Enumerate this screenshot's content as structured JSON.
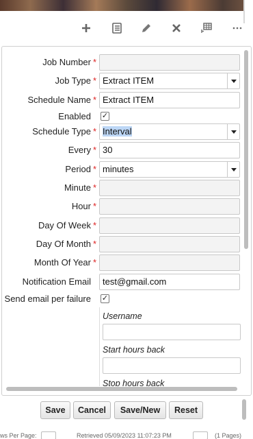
{
  "toolbar": {
    "icons": [
      "add-icon",
      "details-icon",
      "edit-icon",
      "delete-icon",
      "columns-icon",
      "more-icon"
    ]
  },
  "form": {
    "job_number": {
      "label": "Job Number",
      "value": ""
    },
    "job_type": {
      "label": "Job Type",
      "value": "Extract ITEM"
    },
    "schedule_name": {
      "label": "Schedule Name",
      "value": "Extract ITEM"
    },
    "enabled": {
      "label": "Enabled",
      "checked": true
    },
    "schedule_type": {
      "label": "Schedule Type",
      "value": "Interval"
    },
    "every": {
      "label": "Every",
      "value": "30"
    },
    "period": {
      "label": "Period",
      "value": "minutes"
    },
    "minute": {
      "label": "Minute",
      "value": ""
    },
    "hour": {
      "label": "Hour",
      "value": ""
    },
    "day_of_week": {
      "label": "Day Of Week",
      "value": ""
    },
    "day_of_month": {
      "label": "Day Of Month",
      "value": ""
    },
    "month_of_year": {
      "label": "Month Of Year",
      "value": ""
    },
    "notification_email": {
      "label": "Notification Email",
      "value": "test@gmail.com"
    },
    "send_email_per_failure": {
      "label": "Send email per failure",
      "checked": true
    },
    "username": {
      "label": "Username",
      "value": ""
    },
    "start_hours_back": {
      "label": "Start hours back",
      "value": ""
    },
    "stop_hours_back": {
      "label": "Stop hours back"
    },
    "required_mark": "*"
  },
  "buttons": {
    "save": "Save",
    "cancel": "Cancel",
    "save_new": "Save/New",
    "reset": "Reset"
  },
  "footer": {
    "rows_per_page": "ws Per Page:",
    "retrieved": "Retrieved 05/09/2023 11:07:23 PM",
    "pages": "(1 Pages)"
  },
  "colors": {
    "required": "#dd2222",
    "selection_highlight": "#bcd6f5"
  }
}
